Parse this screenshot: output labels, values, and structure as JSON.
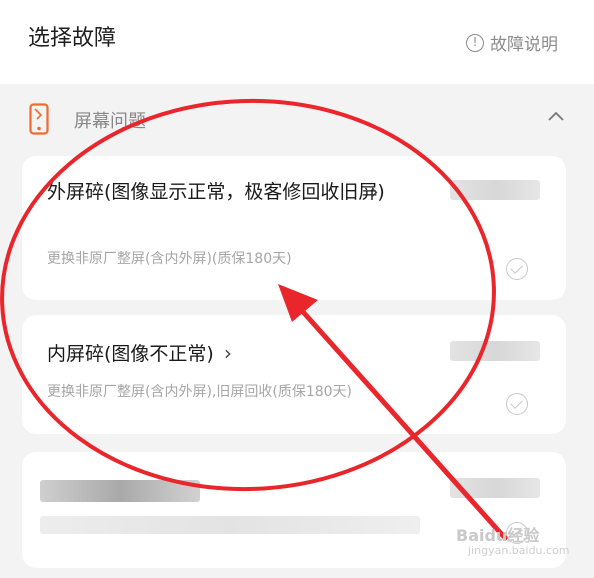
{
  "header": {
    "title": "选择故障",
    "help_label": "故障说明",
    "help_icon_glyph": "!"
  },
  "section": {
    "title": "屏幕问题",
    "icon": "phone-icon",
    "collapse_icon": "chevron-up-icon"
  },
  "options": [
    {
      "title": "外屏碎(图像显示正常，极客修回收旧屏)",
      "chevron": "›",
      "desc": "更换非原厂整屏(含内外屏)(质保180天)",
      "selected": false
    },
    {
      "title": "内屏碎(图像不正常)",
      "chevron": "›",
      "desc": "更换非原厂整屏(含内外屏),旧屏回收(质保180天)",
      "selected": false
    }
  ],
  "colors": {
    "accent": "#f26a2e",
    "annotation_red": "#e8262b"
  },
  "watermark": {
    "brand": "Baidu经验",
    "url": "jingyan.baidu.com"
  }
}
